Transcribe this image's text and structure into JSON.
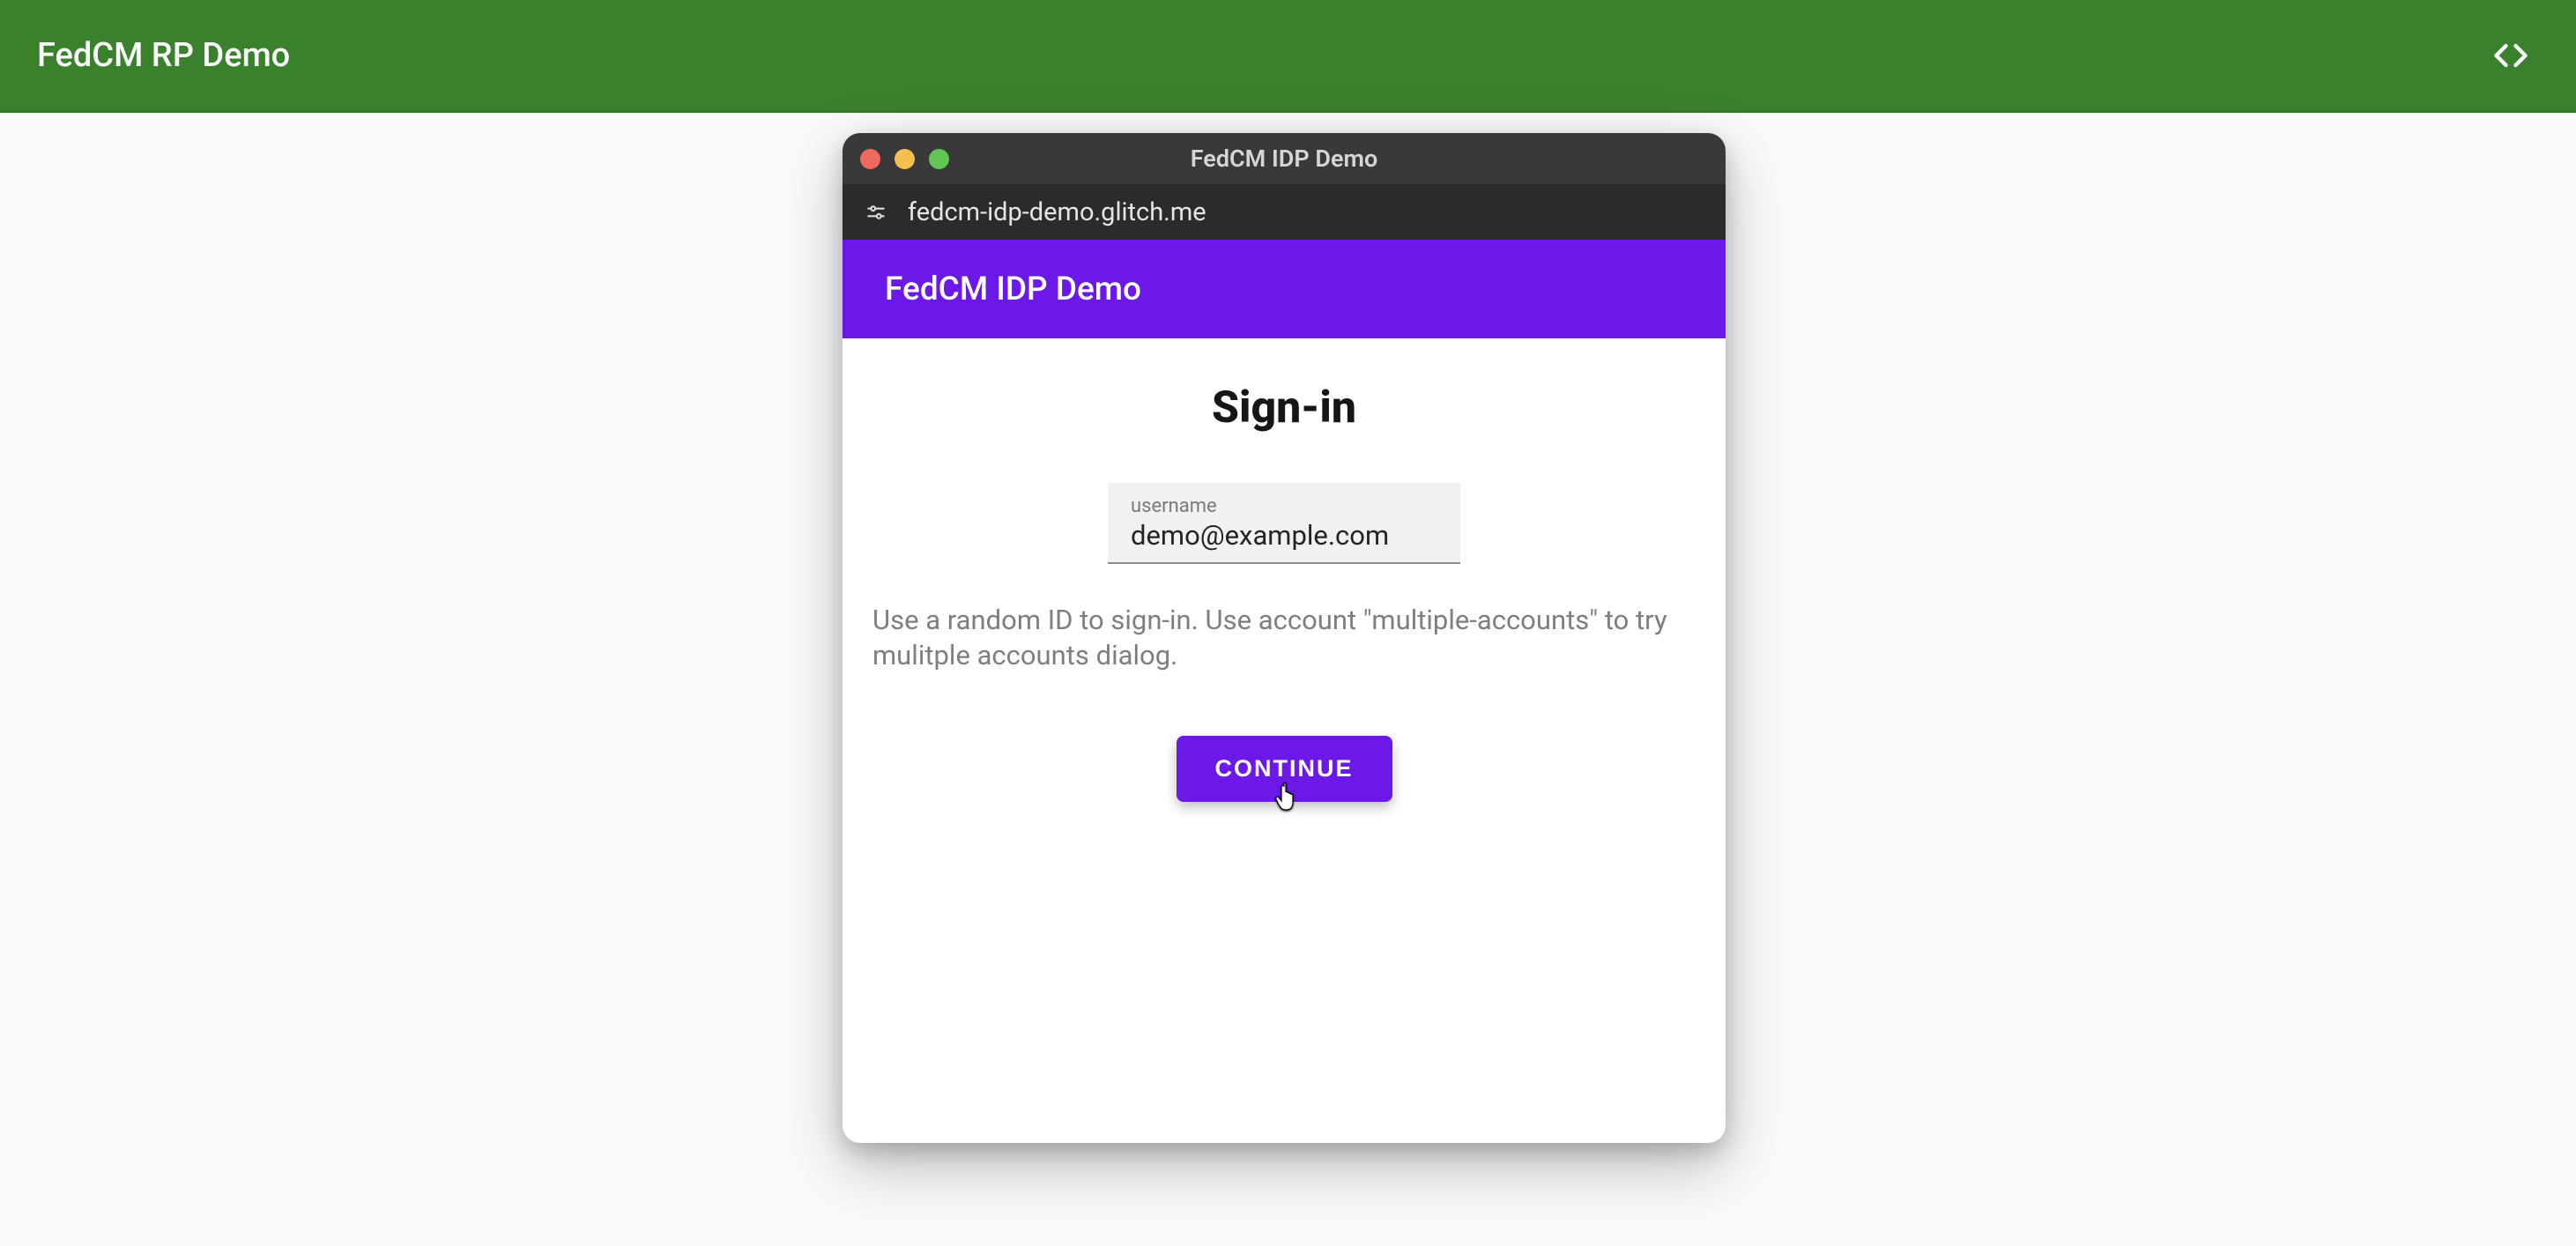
{
  "page": {
    "title": "FedCM RP Demo"
  },
  "popup": {
    "window_title": "FedCM IDP Demo",
    "address": "fedcm-idp-demo.glitch.me",
    "idp_header_title": "FedCM IDP Demo",
    "signin": {
      "heading": "Sign-in",
      "username_label": "username",
      "username_value": "demo@example.com",
      "helper_text": "Use a random ID to sign-in. Use account \"multiple-accounts\" to try mulitple accounts dialog.",
      "continue_label": "CONTINUE"
    }
  }
}
